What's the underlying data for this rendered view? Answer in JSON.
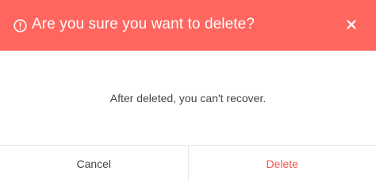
{
  "dialog": {
    "title": "Are you sure you want to delete?",
    "message": "After deleted, you can't recover.",
    "cancel_label": "Cancel",
    "delete_label": "Delete",
    "close_icon": "close-icon",
    "alert_icon": "alert-circle-icon"
  },
  "colors": {
    "header_background": "#ff665f",
    "delete_text": "#f2544c",
    "body_text": "#444444"
  }
}
